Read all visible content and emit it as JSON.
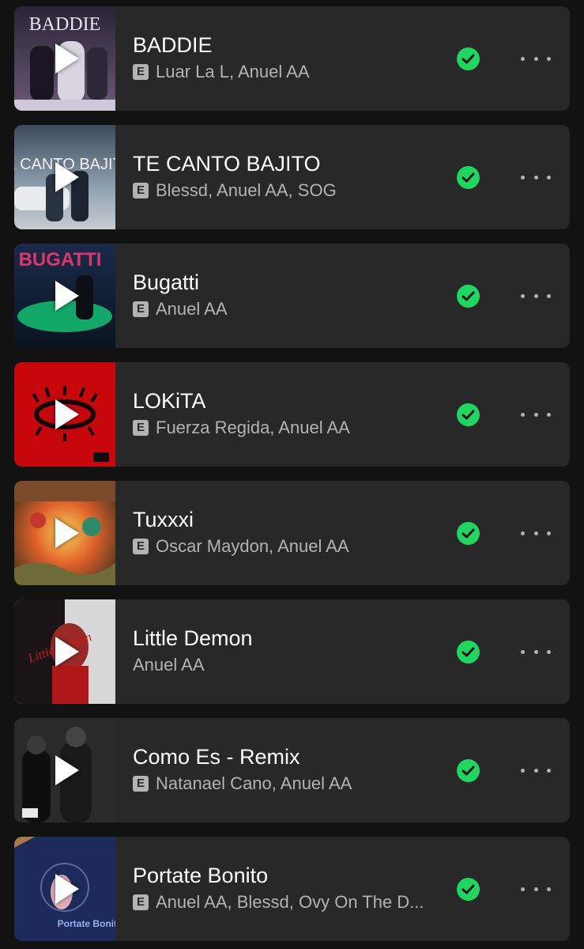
{
  "colors": {
    "background": "#121212",
    "row": "#282828",
    "title": "#ffffff",
    "subtitle": "#b3b3b3",
    "downloaded": "#1ed760"
  },
  "explicit_badge": "E",
  "tracks": [
    {
      "title": "BADDIE",
      "explicit": true,
      "artists": "Luar La L, Anuel AA",
      "cover_text": "BADDIE",
      "downloaded": true
    },
    {
      "title": "TE CANTO BAJITO",
      "explicit": true,
      "artists": "Blessd, Anuel AA, SOG",
      "cover_text": "TE CANTO BAJITO",
      "downloaded": true
    },
    {
      "title": "Bugatti",
      "explicit": true,
      "artists": "Anuel AA",
      "cover_text": "BUGATTI",
      "downloaded": true
    },
    {
      "title": "LOKiTA",
      "explicit": true,
      "artists": "Fuerza Regida, Anuel AA",
      "cover_text": "",
      "downloaded": true
    },
    {
      "title": "Tuxxxi",
      "explicit": true,
      "artists": "Oscar Maydon, Anuel AA",
      "cover_text": "",
      "downloaded": true
    },
    {
      "title": "Little Demon",
      "explicit": false,
      "artists": "Anuel AA",
      "cover_text": "Little Demon",
      "downloaded": true
    },
    {
      "title": "Como Es - Remix",
      "explicit": true,
      "artists": "Natanael Cano, Anuel AA",
      "cover_text": "",
      "downloaded": true
    },
    {
      "title": "Portate Bonito",
      "explicit": true,
      "artists": "Anuel AA, Blessd, Ovy On The D...",
      "cover_text": "Portate Bonito",
      "downloaded": true
    }
  ]
}
